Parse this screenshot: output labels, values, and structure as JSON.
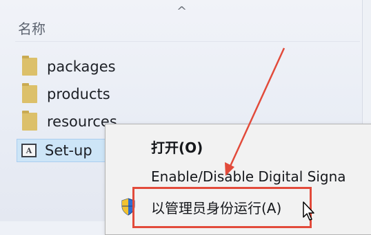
{
  "explorer": {
    "sort_indicator": "^",
    "column_header": "名称",
    "files": [
      {
        "name": "packages",
        "type": "folder",
        "icon": "folder-icon"
      },
      {
        "name": "products",
        "type": "folder",
        "icon": "folder-icon"
      },
      {
        "name": "resources",
        "type": "folder",
        "icon": "folder-icon"
      },
      {
        "name": "Set-up",
        "type": "application",
        "icon": "app-icon",
        "selected": true
      }
    ]
  },
  "context_menu": {
    "items": [
      {
        "label": "打开(O)",
        "bold": true
      },
      {
        "label": "Enable/Disable Digital Signa"
      },
      {
        "label": "以管理员身份运行(A)",
        "icon": "shield-icon"
      }
    ]
  },
  "annotation": {
    "color": "#e24a3a",
    "highlighted_item": "以管理员身份运行(A)"
  },
  "colors": {
    "selection_bg": "#cde5f7",
    "folder": "#dcc06a",
    "menu_bg": "#f2f2f2"
  }
}
